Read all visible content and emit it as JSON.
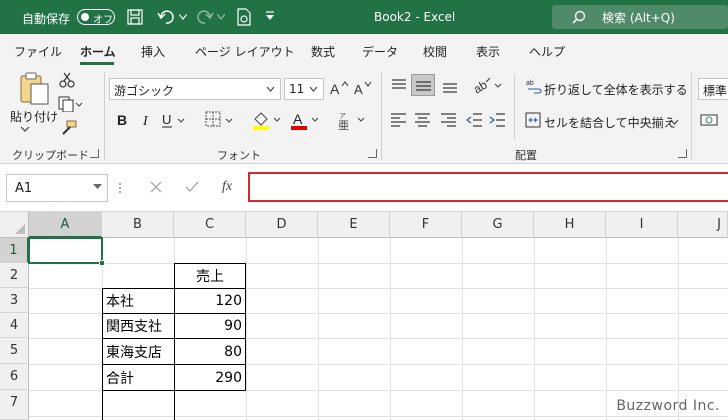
{
  "titlebar": {
    "autosave_label": "自動保存",
    "autosave_state": "オフ",
    "document_title": "Book2 - Excel",
    "search_placeholder": "検索 (Alt+Q)",
    "bg_color": "#217346"
  },
  "tabs": [
    "ファイル",
    "ホーム",
    "挿入",
    "ページ レイアウト",
    "数式",
    "データ",
    "校閲",
    "表示",
    "ヘルプ"
  ],
  "active_tab": "ホーム",
  "ribbon": {
    "clipboard": {
      "paste_label": "貼り付け",
      "group_label": "クリップボード"
    },
    "font": {
      "font_name": "游ゴシック",
      "font_size": "11",
      "group_label": "フォント"
    },
    "alignment": {
      "wrap_text_label": "折り返して全体を表示する",
      "merge_center_label": "セルを結合して中央揃え",
      "group_label": "配置"
    },
    "number": {
      "format_label": "標準"
    }
  },
  "formula_bar": {
    "name_box": "A1",
    "fx_label": "fx",
    "formula_value": ""
  },
  "grid": {
    "columns": [
      "A",
      "B",
      "C",
      "D",
      "E",
      "F",
      "G",
      "H",
      "I",
      "J"
    ],
    "rows": [
      "1",
      "2",
      "3",
      "4",
      "5",
      "6",
      "7"
    ],
    "selected_cell": "A1",
    "cells": {
      "C2": "売上",
      "B3": "本社",
      "C3": "120",
      "B4": "関西支社",
      "C4": "90",
      "B5": "東海支店",
      "C5": "80",
      "B6": "合計",
      "C6": "290"
    }
  },
  "watermark": "Buzzword Inc."
}
